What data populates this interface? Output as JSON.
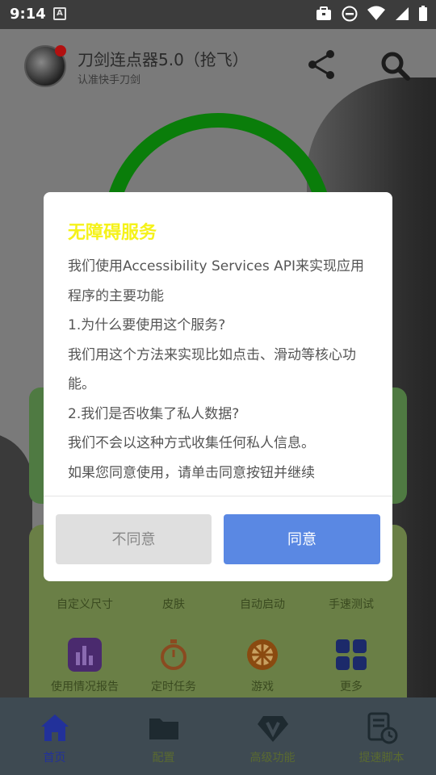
{
  "status_bar": {
    "time": "9:14",
    "notification_letter": "A"
  },
  "app": {
    "title": "刀剑连点器5.0（抢飞）",
    "subtitle": "认准快手刀剑"
  },
  "grid": {
    "row1": [
      "自定义尺寸",
      "皮肤",
      "自动启动",
      "手速测试"
    ],
    "row2": [
      "使用情况报告",
      "定时任务",
      "游戏",
      "更多"
    ]
  },
  "bottom_nav": {
    "items": [
      "首页",
      "配置",
      "高级功能",
      "提速脚本"
    ],
    "active_index": 0
  },
  "dialog": {
    "title": "无障碍服务",
    "lines": [
      "我们使用Accessibility Services API来实现应用程序的主要功能",
      "1.为什么要使用这个服务?",
      "我们用这个方法来实现比如点击、滑动等核心功能。",
      "2.我们是否收集了私人数据?",
      "我们不会以这种方式收集任何私人信息。",
      "如果您同意使用，请单击同意按钮并继续"
    ],
    "disagree_label": "不同意",
    "agree_label": "同意"
  },
  "colors": {
    "dialog_title": "#f5f21a",
    "agree_button": "#5a88e3",
    "disagree_button": "#dfdfdf",
    "ring": "#0a7d0a",
    "nav_active": "#22319a"
  }
}
